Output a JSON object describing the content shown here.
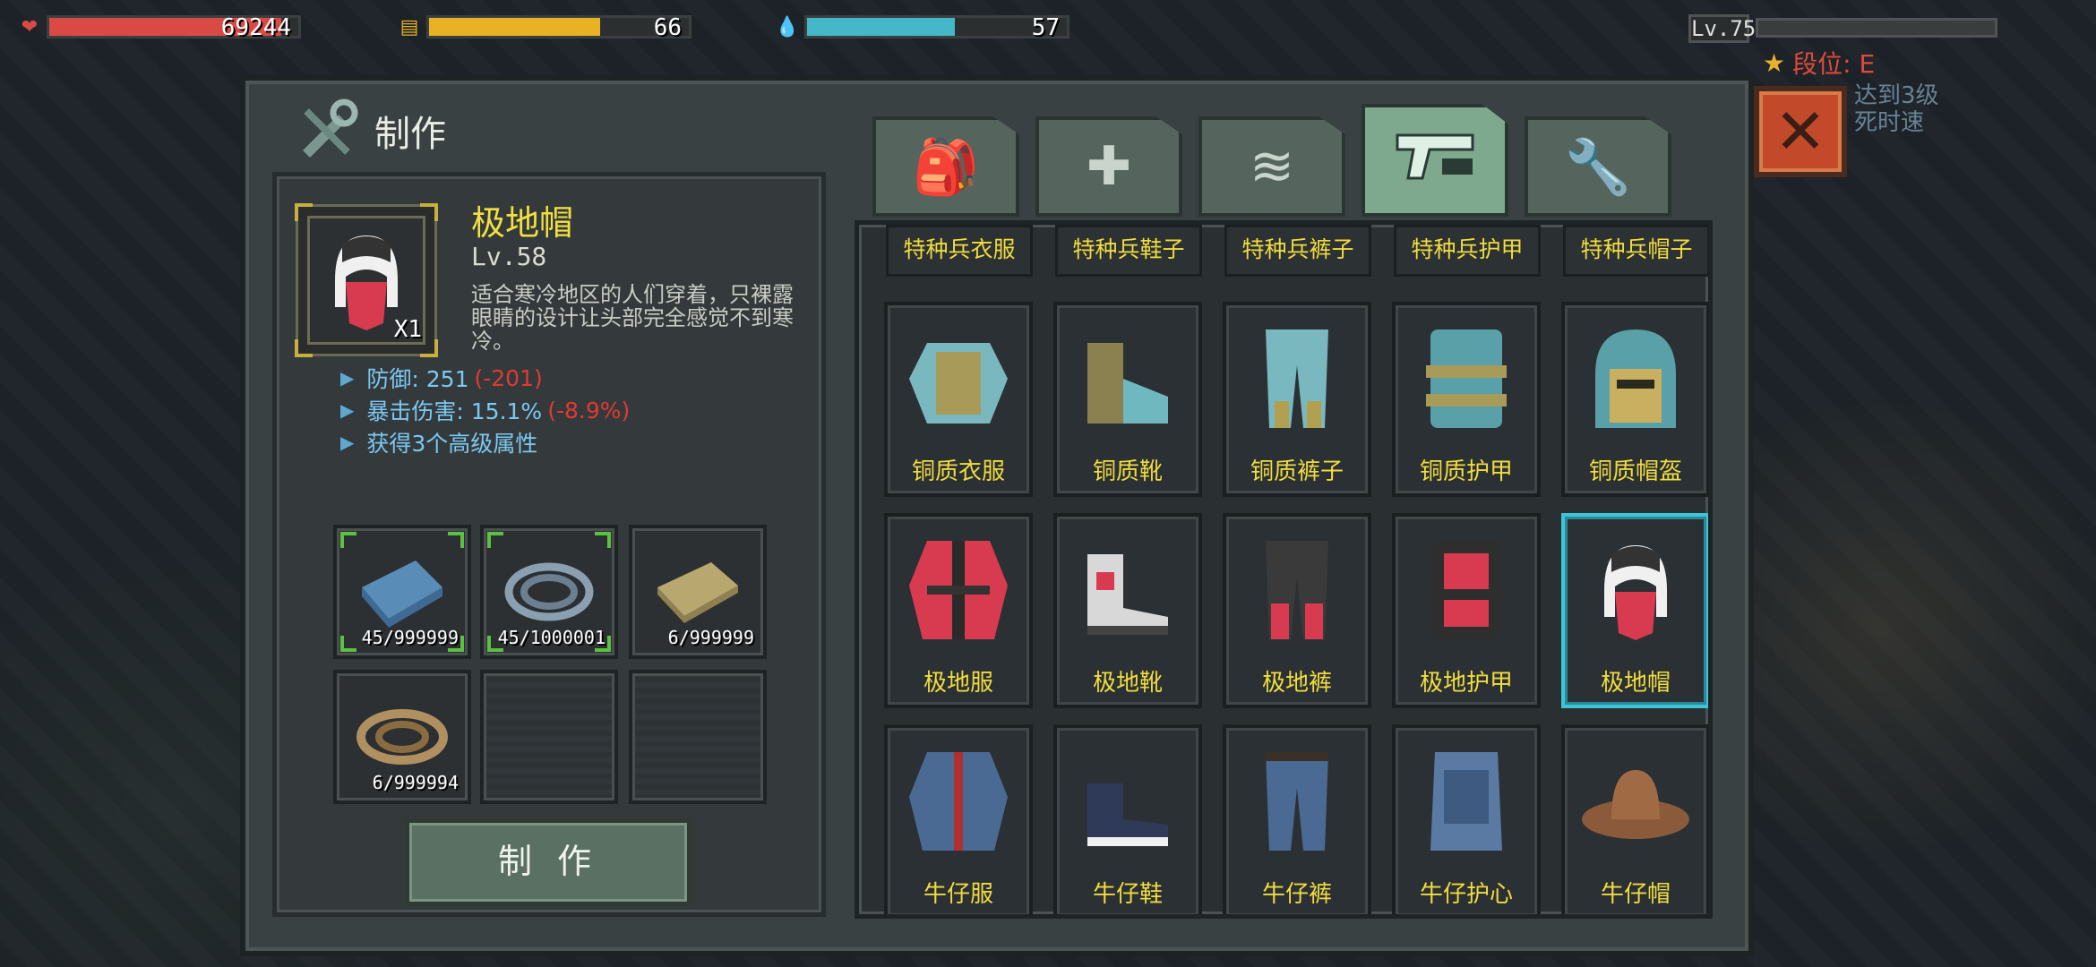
{
  "hud": {
    "hp": {
      "value": "69244",
      "fill": 0.93,
      "color": "#d94a44"
    },
    "food": {
      "value": "66",
      "fill": 0.66,
      "color": "#e8b224"
    },
    "water": {
      "value": "57",
      "fill": 0.57,
      "color": "#44b8c8"
    },
    "level": "Lv.75",
    "rank_label": "段位: E",
    "bg_text_1": "达到3级",
    "bg_text_2": "死时速"
  },
  "panel": {
    "title": "制作"
  },
  "selected_item": {
    "name": "极地帽",
    "level": "Lv.58",
    "quantity": "X1",
    "description": "适合寒冷地区的人们穿着，只裸露眼睛的设计让头部完全感觉不到寒冷。",
    "stats": [
      {
        "label": "防御: 251",
        "delta": "(-201)"
      },
      {
        "label": "暴击伤害: 15.1%",
        "delta": "(-8.9%)"
      },
      {
        "label": "获得3个高级属性",
        "delta": ""
      }
    ]
  },
  "materials": [
    {
      "count": "45/999999",
      "icon": "blue-cloth-icon",
      "ok": true
    },
    {
      "count": "45/1000001",
      "icon": "rope-coil-icon",
      "ok": true
    },
    {
      "count": "6/999999",
      "icon": "tan-cloth-icon",
      "ok": false
    },
    {
      "count": "6/999994",
      "icon": "brown-rope-icon",
      "ok": false
    },
    {
      "count": "",
      "icon": "",
      "ok": false
    },
    {
      "count": "",
      "icon": "",
      "ok": false
    }
  ],
  "craft_button": "制 作",
  "tabs": [
    {
      "icon": "backpack-icon"
    },
    {
      "icon": "medkit-icon"
    },
    {
      "icon": "wing-icon"
    },
    {
      "icon": "pistol-icon",
      "active": true
    },
    {
      "icon": "wrench-icon"
    }
  ],
  "top_labels": [
    "特种兵衣服",
    "特种兵鞋子",
    "特种兵裤子",
    "特种兵护甲",
    "特种兵帽子"
  ],
  "grid": [
    [
      "铜质衣服",
      "铜质靴",
      "铜质裤子",
      "铜质护甲",
      "铜质帽盔"
    ],
    [
      "极地服",
      "极地靴",
      "极地裤",
      "极地护甲",
      "极地帽"
    ],
    [
      "牛仔服",
      "牛仔鞋",
      "牛仔裤",
      "牛仔护心",
      "牛仔帽"
    ]
  ],
  "selected_cell": "极地帽",
  "close_icon": "close-x-icon"
}
